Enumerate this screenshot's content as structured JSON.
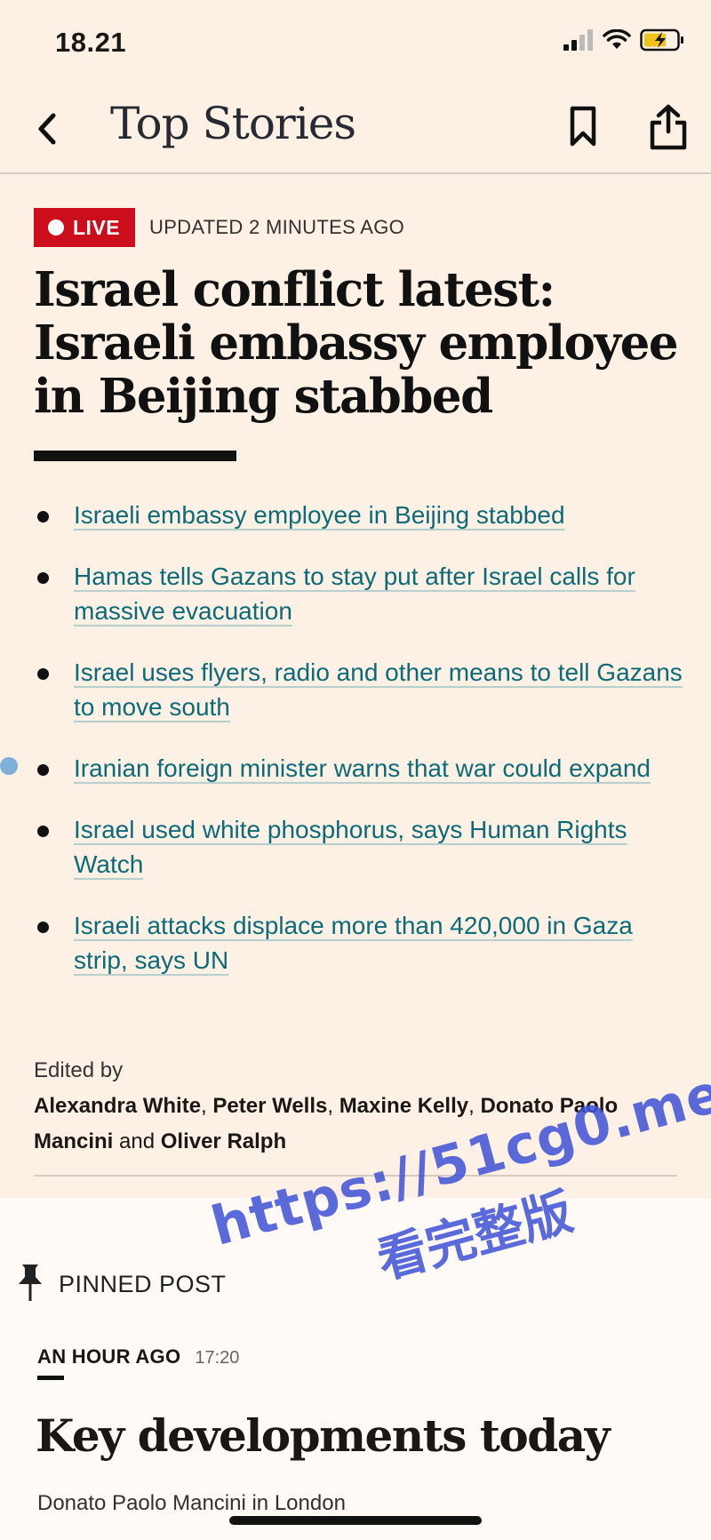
{
  "status_bar": {
    "time": "18.21"
  },
  "nav": {
    "title": "Top Stories"
  },
  "article": {
    "live_label": "LIVE",
    "updated": "UPDATED 2 MINUTES AGO",
    "headline": "Israel conflict latest: Israeli embassy employee in Beijing stabbed",
    "bullets": [
      "Israeli embassy employee in Beijing stabbed",
      "Hamas tells Gazans to stay put after Israel calls for massive evacuation",
      "Israel uses flyers, radio and other means to tell Gazans to move south",
      "Iranian foreign minister warns that war could expand",
      "Israel used white phosphorus, says Human Rights Watch",
      "Israeli attacks displace more than 420,000 in Gaza strip, says UN"
    ],
    "edited_by_label": "Edited by",
    "editors": [
      "Alexandra White",
      "Peter Wells",
      "Maxine Kelly",
      "Donato Paolo Mancini",
      "Oliver Ralph"
    ],
    "editors_and": "and"
  },
  "pinned": {
    "label": "PINNED POST",
    "time_ago": "AN HOUR AGO",
    "time": "17:20",
    "title": "Key developments today",
    "byline": "Donato Paolo Mancini in London"
  },
  "watermark": {
    "line1": "https://51cg0.me",
    "line2": "看完整版"
  },
  "colors": {
    "background": "#fdf1e6",
    "live_red": "#cc0d1b",
    "link_teal": "#0d6a77",
    "watermark_blue": "#3f52d6"
  }
}
